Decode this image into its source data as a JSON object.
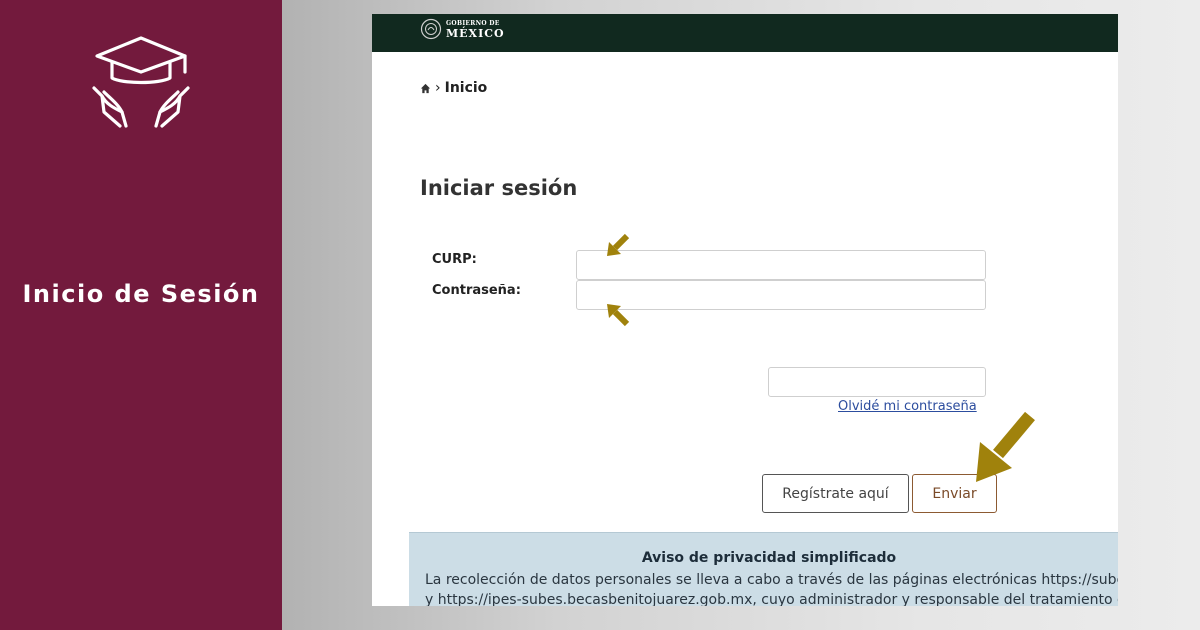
{
  "sidebar": {
    "title": "Inicio de Sesión",
    "background_color": "#731a3d",
    "logo_icon": "graduation-cap-hands-icon"
  },
  "gov_header": {
    "line1": "GOBIERNO DE",
    "line2": "MÉXICO",
    "background_color": "#11291f"
  },
  "breadcrumb": {
    "icon": "home-icon",
    "separator": "›",
    "current": "Inicio"
  },
  "login_form": {
    "title": "Iniciar sesión",
    "curp_label": "CURP:",
    "curp_value": "",
    "password_label": "Contraseña:",
    "password_value": "",
    "captcha_value": "",
    "forgot_link": "Olvidé mi contraseña",
    "register_button": "Regístrate aquí",
    "submit_button": "Enviar"
  },
  "privacy_notice": {
    "title": "Aviso de privacidad simplificado",
    "line1": "La recolección de datos personales se lleva a cabo a través de las páginas electrónicas https://subes.b",
    "line2": "y https://ipes-subes.becasbenitojuarez.gob.mx, cuyo administrador y responsable del tratamiento es"
  },
  "annotation_color": "#a0820c"
}
